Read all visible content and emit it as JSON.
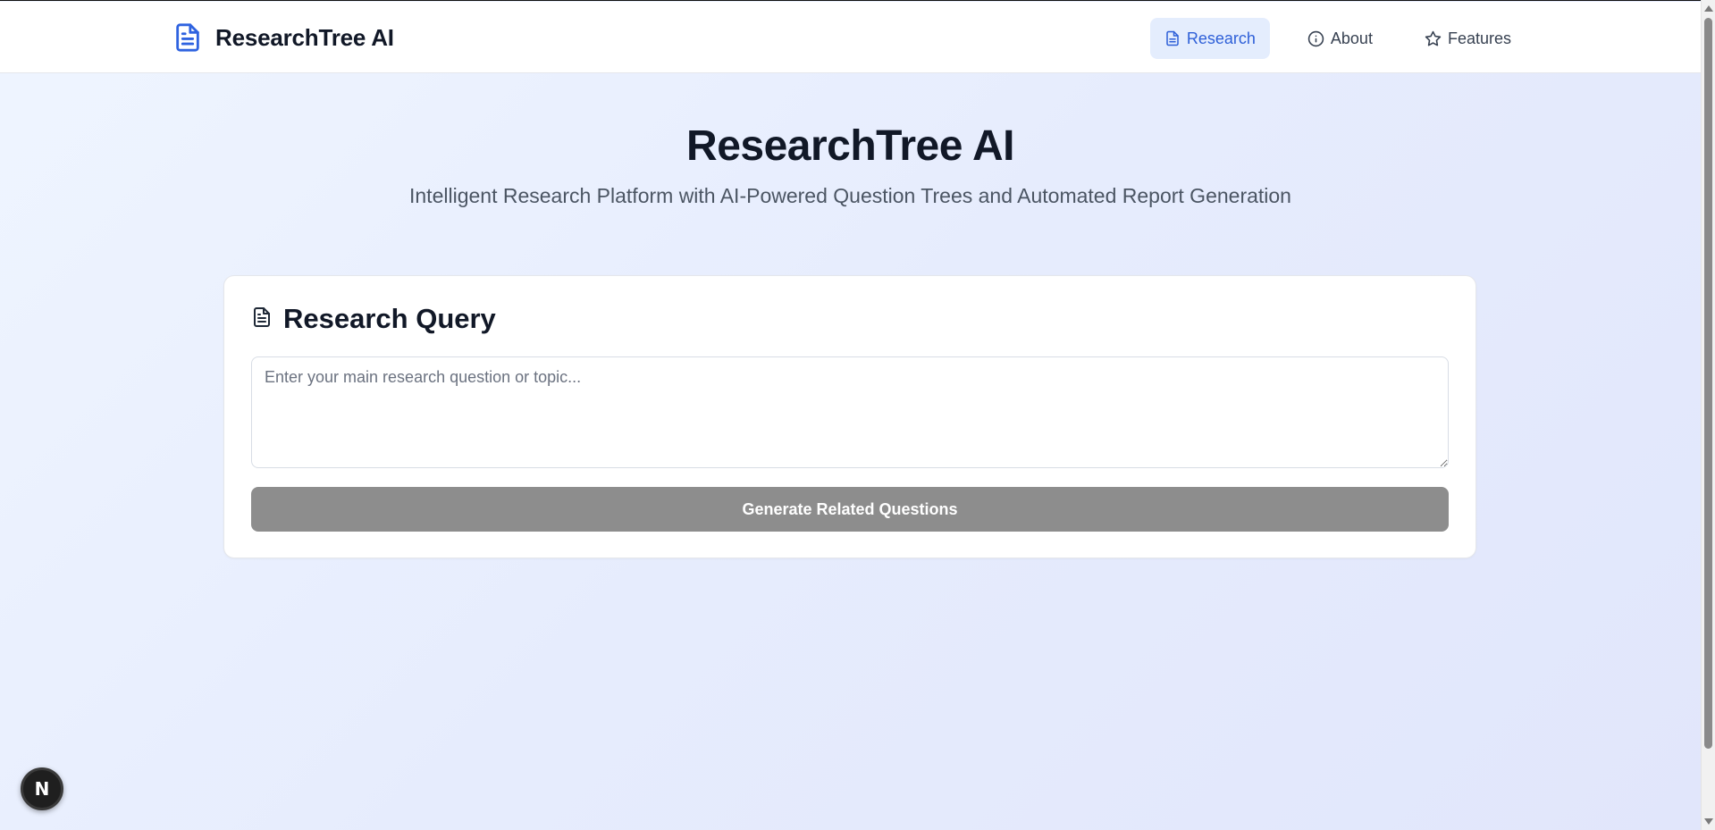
{
  "header": {
    "brand": "ResearchTree AI",
    "brand_icon": "document-icon",
    "nav": [
      {
        "label": "Research",
        "icon": "document-icon",
        "active": true
      },
      {
        "label": "About",
        "icon": "info-icon",
        "active": false
      },
      {
        "label": "Features",
        "icon": "star-icon",
        "active": false
      }
    ]
  },
  "hero": {
    "title": "ResearchTree AI",
    "subtitle": "Intelligent Research Platform with AI-Powered Question Trees and Automated Report Generation"
  },
  "query_card": {
    "title": "Research Query",
    "title_icon": "document-icon",
    "input_placeholder": "Enter your main research question or topic...",
    "input_value": "",
    "button_label": "Generate Related Questions"
  },
  "badge": {
    "label": "N"
  },
  "colors": {
    "accent": "#2d5fd8",
    "active_nav_bg": "#e4edfd",
    "button_disabled": "#8d8d8d",
    "title_text": "#111827"
  }
}
